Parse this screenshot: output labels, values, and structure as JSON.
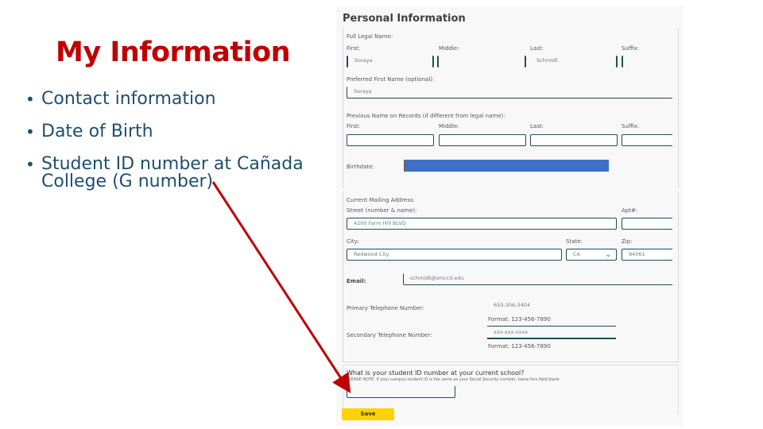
{
  "slide": {
    "title": "My Information",
    "bullets": [
      "Contact information",
      "Date of Birth",
      "Student ID number at Cañada College (G number)"
    ],
    "bullet_line2": "College (G number)",
    "bullet_line1": "Student ID number at Cañada",
    "title_color": "#c00000",
    "text_color": "#1f4e6e",
    "arrow_color": "#c00000"
  },
  "form": {
    "title": "Personal Information",
    "legal_name": {
      "label": "Full Legal Name:",
      "first_label": "First:",
      "first_value": "Soraya",
      "middle_label": "Middle:",
      "middle_value": "",
      "last_label": "Last:",
      "last_value": "Schmidt",
      "suffix_label": "Suffix:",
      "suffix_value": ""
    },
    "preferred": {
      "label": "Preferred First Name (optional):",
      "value": "Soraya"
    },
    "previous": {
      "label": "Previous Name on Records (if different from legal name):",
      "first_label": "First:",
      "middle_label": "Middle:",
      "last_label": "Last:",
      "suffix_label": "Suffix:"
    },
    "birthdate": {
      "label": "Birthdate:",
      "value": "",
      "redacted": true
    },
    "address": {
      "label": "Current Mailing Address:",
      "street_label": "Street (number & name):",
      "street_value": "4200 Farm Hill BLVD",
      "apt_label": "Apt#:",
      "apt_value": "",
      "city_label": "City:",
      "city_value": "Redwood City",
      "state_label": "State:",
      "state_value": "CA",
      "zip_label": "Zip:",
      "zip_value": "94061"
    },
    "email": {
      "label": "Email:",
      "value": "schmidt@smccd.edu"
    },
    "primary_phone": {
      "label": "Primary Telephone Number:",
      "value": "650-306-3404",
      "format": "Format: 123-456-7890"
    },
    "secondary_phone": {
      "label": "Secondary Telephone Number:",
      "value": "xxx-xxx-xxxx",
      "format": "Format: 123-456-7890"
    },
    "student_id": {
      "question": "What is your student ID number at your current school?",
      "note": "PLEASE NOTE: If your campus student ID is the same as your Social Security number, leave this field blank",
      "value": ""
    },
    "save_label": "Save",
    "accent": "#1d4f54",
    "save_color": "#ffd200"
  }
}
